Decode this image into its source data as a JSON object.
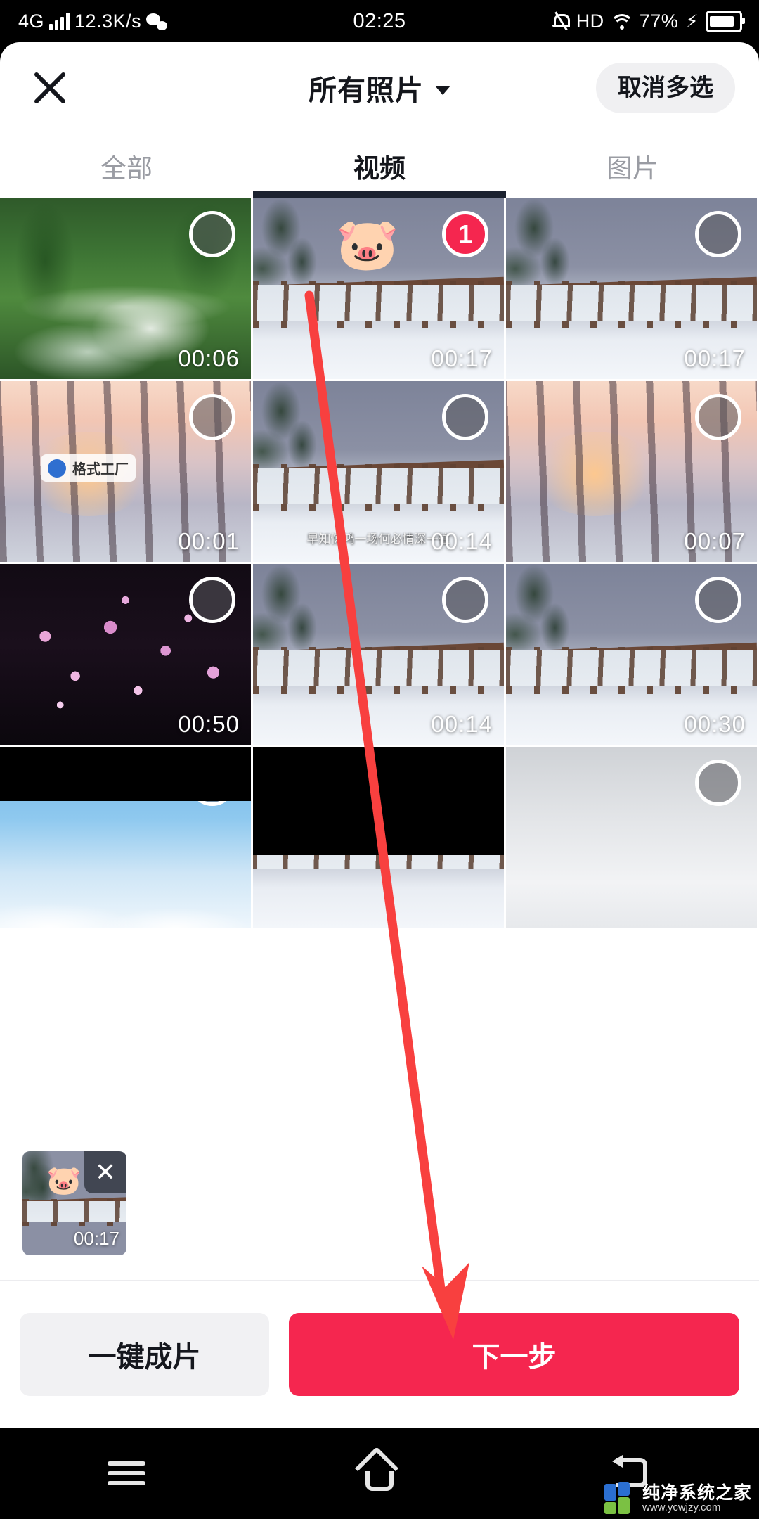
{
  "status_bar": {
    "network_type": "4G",
    "speed": "12.3K/s",
    "wechat_icon": "wechat-icon",
    "time": "02:25",
    "mute_icon": "mute-bell-icon",
    "hd_label": "HD",
    "wifi_icon": "wifi-icon",
    "battery_percent": "77%",
    "charging_icon": "lightning-bolt-icon"
  },
  "header": {
    "close_icon": "close-icon",
    "title": "所有照片",
    "dropdown_icon": "chevron-down-icon",
    "cancel_multi_label": "取消多选"
  },
  "tabs": [
    {
      "label": "全部",
      "active": false
    },
    {
      "label": "视频",
      "active": true
    },
    {
      "label": "图片",
      "active": false
    }
  ],
  "grid": {
    "rows": [
      [
        {
          "duration": "00:06",
          "selected": false,
          "scene": "waterfall"
        },
        {
          "duration": "00:17",
          "selected": true,
          "badge": "1",
          "scene": "snow-dusk",
          "sticker": "🐷"
        },
        {
          "duration": "00:17",
          "selected": false,
          "scene": "snow-dusk"
        }
      ],
      [
        {
          "duration": "00:01",
          "selected": false,
          "scene": "sunset-trees",
          "watermark_text": "格式工厂"
        },
        {
          "duration": "00:14",
          "selected": false,
          "scene": "snow-dusk",
          "subtitle": "早知惊鸿一场何必情深一往"
        },
        {
          "duration": "00:07",
          "selected": false,
          "scene": "sunset-trees"
        }
      ],
      [
        {
          "duration": "00:50",
          "selected": false,
          "scene": "blossom"
        },
        {
          "duration": "00:14",
          "selected": false,
          "scene": "snow-dusk"
        },
        {
          "duration": "00:30",
          "selected": false,
          "scene": "snow-dusk"
        }
      ],
      [
        {
          "duration": "",
          "selected": false,
          "scene": "birds"
        },
        {
          "duration": "",
          "selected": false,
          "scene": "snow-dusk"
        },
        {
          "duration": "",
          "selected": false,
          "scene": "fog"
        }
      ]
    ]
  },
  "selected_tray": [
    {
      "duration": "00:17",
      "sticker": "🐷",
      "remove_icon": "close-icon"
    }
  ],
  "actions": {
    "secondary_label": "一键成片",
    "primary_label": "下一步",
    "primary_color": "#f5264f",
    "secondary_color": "#f1f1f3"
  },
  "nav_bar": {
    "menu_icon": "menu-icon",
    "home_icon": "home-icon",
    "back_icon": "back-icon"
  },
  "watermark": {
    "title": "纯净系统之家",
    "url": "www.ycwjzy.com"
  },
  "annotation": {
    "arrow_color": "#f8403f",
    "description": "red-arrow-pointing-to-next-step-button"
  }
}
